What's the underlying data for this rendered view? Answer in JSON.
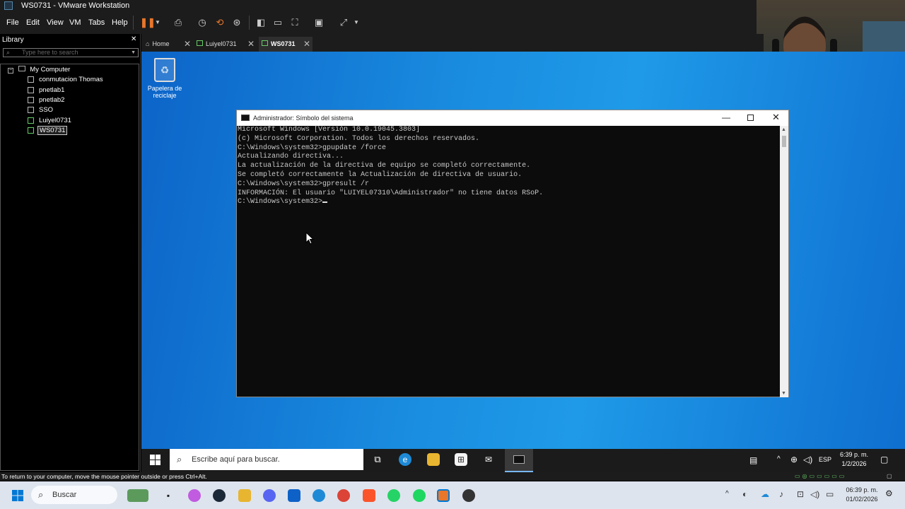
{
  "window": {
    "title": "WS0731 - VMware Workstation"
  },
  "menu": [
    "File",
    "Edit",
    "View",
    "VM",
    "Tabs",
    "Help"
  ],
  "library": {
    "title": "Library",
    "close": "✕",
    "search_placeholder": "Type here to search",
    "items": [
      "My Computer",
      "conmutacion Thomas",
      "pnetlab1",
      "pnetlab2",
      "SSO",
      "Luiyel0731",
      "WS0731"
    ]
  },
  "tabs": [
    {
      "label": "Home"
    },
    {
      "label": "Luiyel0731"
    },
    {
      "label": "WS0731"
    }
  ],
  "desktop": {
    "recycle_label": "Papelera de reciclaje"
  },
  "cmd": {
    "title": "Administrador: Símbolo del sistema",
    "lines": [
      "Microsoft Windows [Versión 10.0.19045.3803]",
      "(c) Microsoft Corporation. Todos los derechos reservados.",
      "",
      "C:\\Windows\\system32>gpupdate /force",
      "Actualizando directiva...",
      "",
      "La actualización de la directiva de equipo se completó correctamente.",
      "Se completó correctamente la Actualización de directiva de usuario.",
      "",
      "",
      "C:\\Windows\\system32>gpresult /r",
      "INFORMACIÓN: El usuario \"LUIYEL07310\\Administrador\" no tiene datos RSoP.",
      ""
    ],
    "prompt": "C:\\Windows\\system32>"
  },
  "guest_taskbar": {
    "search_placeholder": "Escribe aquí para buscar.",
    "lang": "ESP",
    "time": "6:39 p. m.",
    "date": "1/2/2026"
  },
  "status": {
    "text": "To return to your computer, move the mouse pointer outside or press Ctrl+Alt."
  },
  "host_taskbar": {
    "search": "Buscar",
    "time": "06:39 p. m.",
    "date": "01/02/2026"
  },
  "colors": {
    "accent": "#0078d4",
    "pause": "#e8762b",
    "cmd_bg": "#0c0c0c"
  }
}
